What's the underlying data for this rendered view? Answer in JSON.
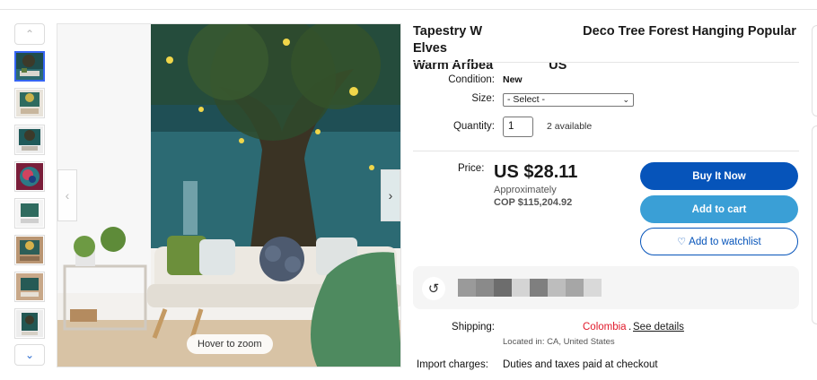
{
  "product": {
    "title_line1": "Tapestry W",
    "title_line1_rest": "e Deco Tree Forest Hanging Popular Elves",
    "title_line2": "Warm Arfbea",
    "title_line2_rest": "US"
  },
  "gallery": {
    "zoom_hint": "Hover to zoom",
    "thumb_count": 8,
    "selected_index": 0
  },
  "details": {
    "condition_label": "Condition:",
    "condition_value": "New",
    "size_label": "Size:",
    "size_selected": "- Select -",
    "quantity_label": "Quantity:",
    "quantity_value": "1",
    "available": "2 available"
  },
  "pricing": {
    "price_label": "Price:",
    "price": "US $28.11",
    "approx_label": "Approximately",
    "approx_value": "COP $115,204.92"
  },
  "actions": {
    "buy_now": "Buy It Now",
    "add_to_cart": "Add to cart",
    "add_to_watchlist": "Add to watchlist"
  },
  "shipping": {
    "label": "Shipping:",
    "destination": "Colombia",
    "see_details": "See details",
    "located_in": "Located in: CA, United States"
  },
  "import": {
    "label": "Import charges:",
    "value": "Duties and taxes paid at checkout"
  },
  "colors": {
    "primary_blue": "#0654ba",
    "cart_blue": "#3a9fd6",
    "destination_red": "#e11a2b"
  }
}
